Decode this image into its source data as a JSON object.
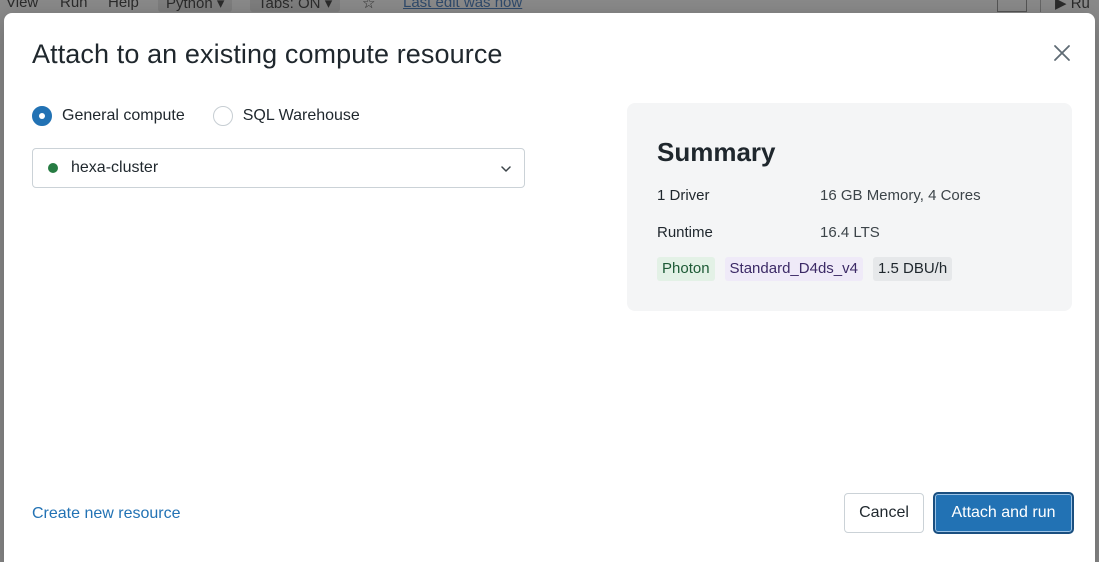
{
  "background": {
    "menu": [
      "View",
      "Run",
      "Help"
    ],
    "language_chip": "Python",
    "tabs_chip": "Tabs: ON",
    "last_edit": "Last edit was now",
    "run_label": "Ru"
  },
  "modal": {
    "title": "Attach to an existing compute resource",
    "radio_options": [
      {
        "label": "General compute",
        "checked": true
      },
      {
        "label": "SQL Warehouse",
        "checked": false
      }
    ],
    "selected_compute": "hexa-cluster",
    "status_color": "#277c43",
    "summary": {
      "title": "Summary",
      "rows": [
        {
          "label": "1 Driver",
          "value": "16 GB Memory, 4 Cores"
        },
        {
          "label": "Runtime",
          "value": "16.4 LTS"
        }
      ],
      "tags": [
        "Photon",
        "Standard_D4ds_v4",
        "1.5 DBU/h"
      ]
    },
    "create_link": "Create new resource",
    "cancel_label": "Cancel",
    "primary_label": "Attach and run",
    "accent_color": "#2272b4"
  }
}
